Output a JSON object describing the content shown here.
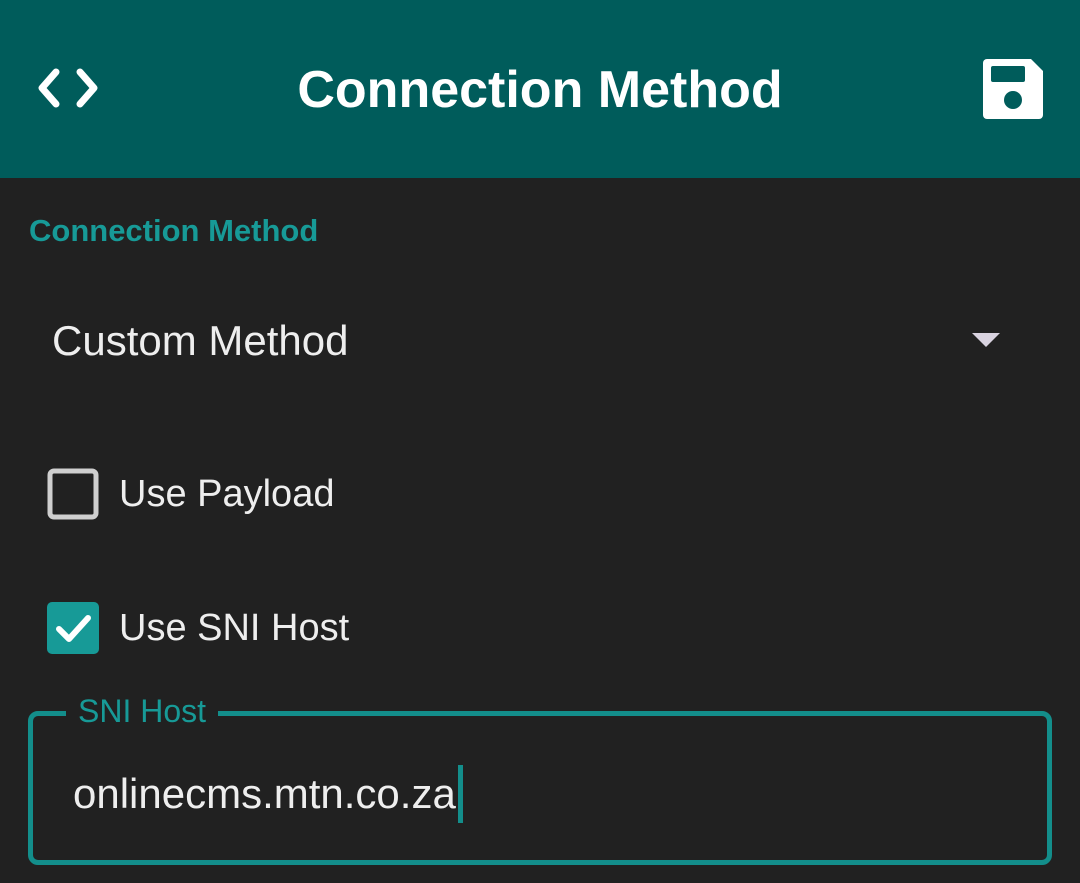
{
  "appbar": {
    "title": "Connection Method",
    "left_icon": "code-icon",
    "right_icon": "save-icon",
    "background": "#005c5b"
  },
  "section": {
    "label": "Connection Method"
  },
  "method_select": {
    "selected": "Custom Method"
  },
  "options": {
    "use_payload": {
      "label": "Use Payload",
      "checked": false
    },
    "use_sni_host": {
      "label": "Use SNI Host",
      "checked": true
    }
  },
  "sni_field": {
    "label": "SNI Host",
    "value": "onlinecms.mtn.co.za"
  },
  "colors": {
    "accent": "#179a97",
    "background": "#212121",
    "text": "#eeeeee"
  }
}
